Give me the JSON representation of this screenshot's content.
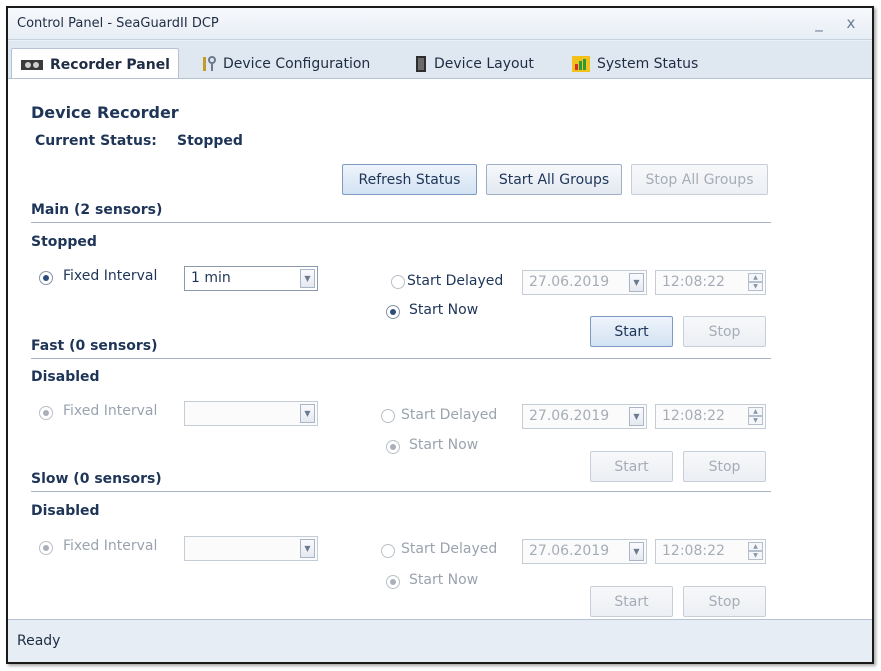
{
  "window": {
    "title": "Control Panel - SeaGuardII DCP",
    "minimize": "_",
    "close": "x"
  },
  "tabs": [
    {
      "label": "Recorder Panel",
      "icon": "recorder-icon"
    },
    {
      "label": "Device Configuration",
      "icon": "tools-icon"
    },
    {
      "label": "Device Layout",
      "icon": "device-icon"
    },
    {
      "label": "System Status",
      "icon": "status-chart-icon"
    }
  ],
  "recorder": {
    "heading": "Device Recorder",
    "current_status_label": "Current Status:",
    "current_status_value": "Stopped",
    "buttons": {
      "refresh": "Refresh Status",
      "start_all": "Start All Groups",
      "stop_all": "Stop All Groups"
    }
  },
  "groups": [
    {
      "title": "Main (2 sensors)",
      "state": "Stopped",
      "fixed_interval_label": "Fixed Interval",
      "interval_value": "1 min",
      "start_delayed_label": "Start Delayed",
      "date": "27.06.2019",
      "time": "12:08:22",
      "start_now_label": "Start Now",
      "start_label": "Start",
      "stop_label": "Stop"
    },
    {
      "title": "Fast (0 sensors)",
      "state": "Disabled",
      "fixed_interval_label": "Fixed Interval",
      "interval_value": "",
      "start_delayed_label": "Start Delayed",
      "date": "27.06.2019",
      "time": "12:08:22",
      "start_now_label": "Start Now",
      "start_label": "Start",
      "stop_label": "Stop"
    },
    {
      "title": "Slow (0 sensors)",
      "state": "Disabled",
      "fixed_interval_label": "Fixed Interval",
      "interval_value": "",
      "start_delayed_label": "Start Delayed",
      "date": "27.06.2019",
      "time": "12:08:22",
      "start_now_label": "Start Now",
      "start_label": "Start",
      "stop_label": "Stop"
    }
  ],
  "statusbar": {
    "text": "Ready"
  }
}
